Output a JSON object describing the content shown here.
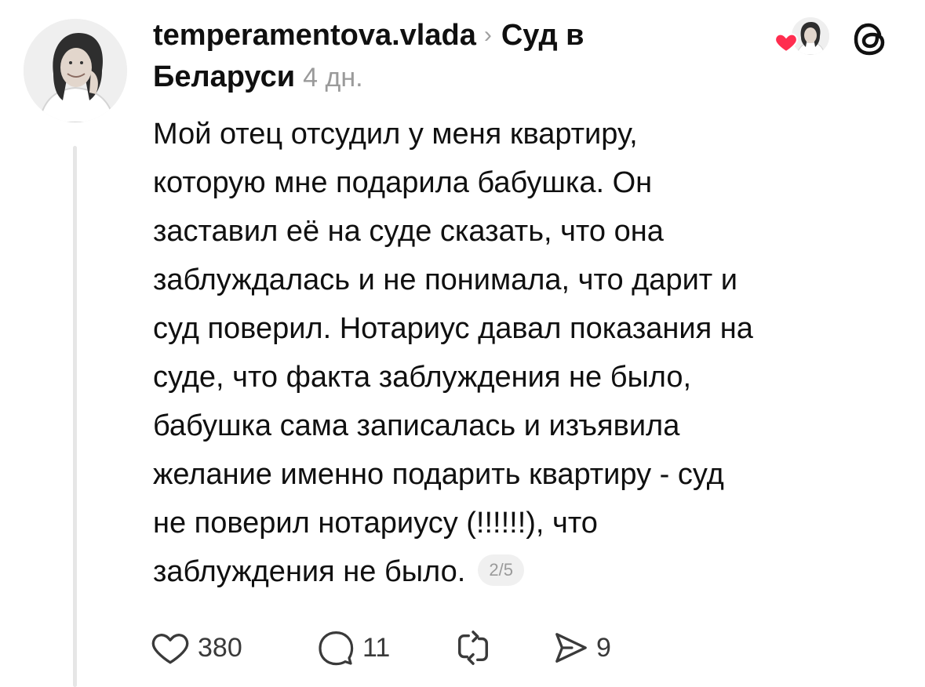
{
  "post": {
    "author": "temperamentova.vlada",
    "community": "Суд в Беларуси",
    "time_ago": "4 дн.",
    "text_lines": [
      "Мой отец отсудил у меня квартиру,",
      "которую мне подарила бабушка. Он",
      "заставил её на суде сказать, что она",
      "заблуждалась и не понимала, что дарит и",
      "суд поверил. Нотариус давал показания на",
      "суде, что факта заблуждения не было,",
      "бабушка сама записалась и изъявила",
      "желание именно подарить квартиру - суд",
      "не поверил нотариусу (!!!!!!), что"
    ],
    "last_line": "заблуждения не было.",
    "page_indicator": "2/5"
  },
  "actions": {
    "likes": "380",
    "replies": "11",
    "shares": "9"
  },
  "icons": {
    "header": [
      "chevron-right-icon",
      "heart-icon",
      "threads-logo-icon"
    ],
    "actions": [
      "heart-icon",
      "comment-icon",
      "repost-icon",
      "send-icon"
    ]
  },
  "colors": {
    "like_heart": "#ff2d4f",
    "text": "#101010",
    "muted": "#9a9a9a",
    "thread_line": "#e6e6e6"
  }
}
